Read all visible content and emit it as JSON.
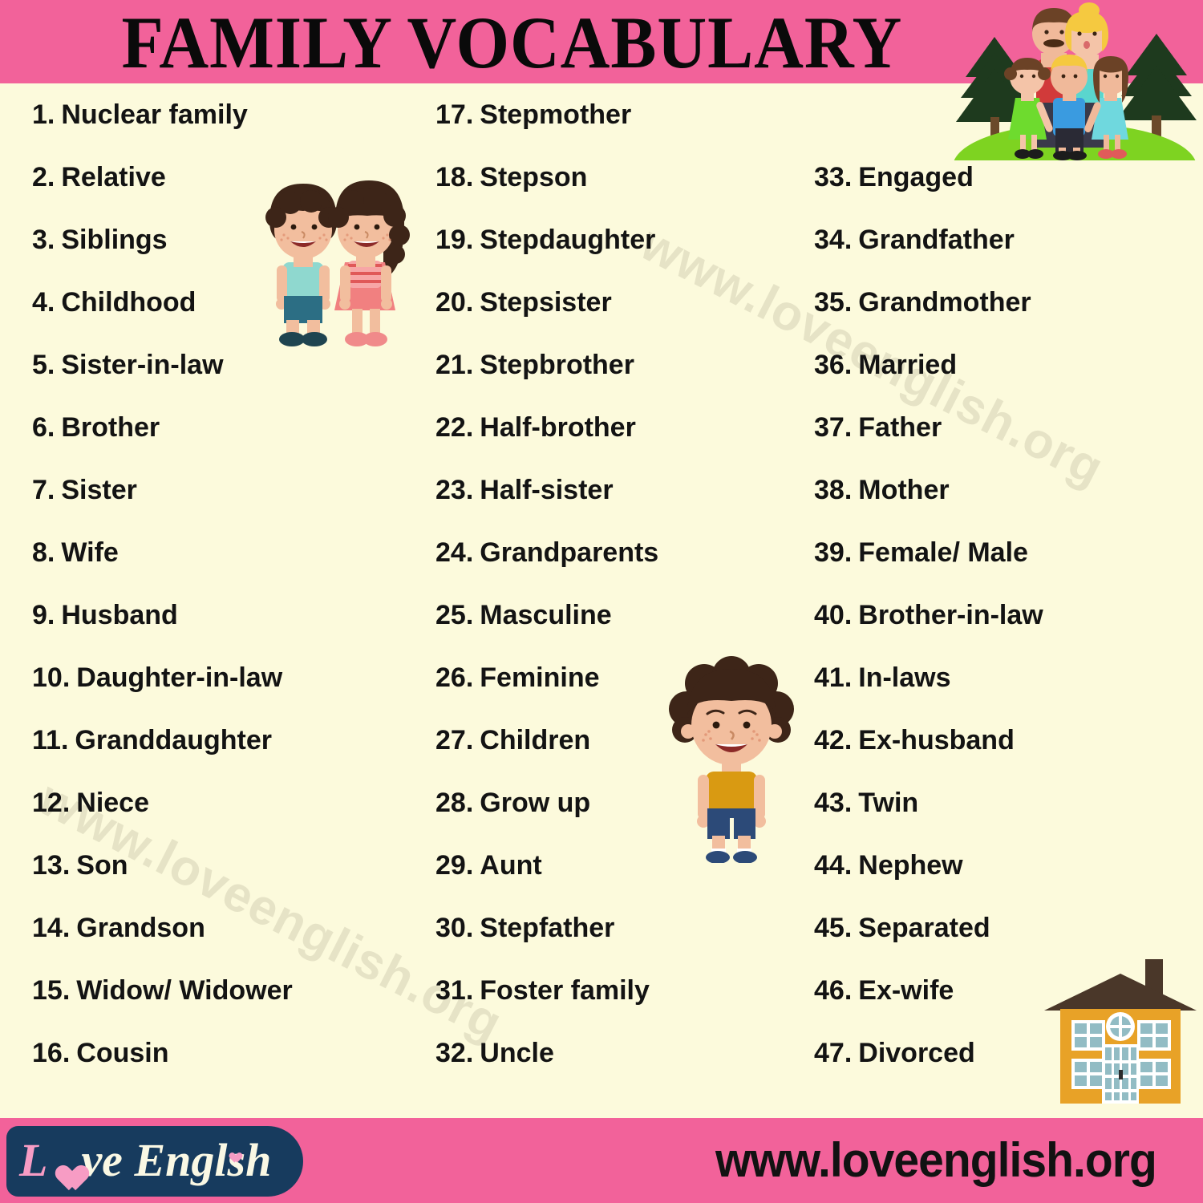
{
  "header": {
    "title": "FAMILY VOCABULARY",
    "band_color": "#F2629A",
    "illustration": "family-in-park-illustration"
  },
  "page": {
    "background_color": "#FCFADC",
    "text_color": "#131313"
  },
  "watermarks": [
    {
      "text": "www.loveenglish.org",
      "color": "#E6E3C6"
    },
    {
      "text": "www.loveenglish.org",
      "color": "#E6E3C6"
    }
  ],
  "illustrations": [
    {
      "name": "boy-and-girl-holding-hands-illustration"
    },
    {
      "name": "smiling-boy-illustration"
    },
    {
      "name": "house-illustration"
    }
  ],
  "columns": [
    {
      "name": "column-one",
      "items": [
        {
          "num": "1.",
          "label": "Nuclear family"
        },
        {
          "num": "2.",
          "label": "Relative"
        },
        {
          "num": "3.",
          "label": "Siblings"
        },
        {
          "num": "4.",
          "label": "Childhood"
        },
        {
          "num": "5.",
          "label": "Sister-in-law"
        },
        {
          "num": "6.",
          "label": "Brother"
        },
        {
          "num": "7.",
          "label": "Sister"
        },
        {
          "num": "8.",
          "label": "Wife"
        },
        {
          "num": "9.",
          "label": "Husband"
        },
        {
          "num": "10.",
          "label": "Daughter-in-law"
        },
        {
          "num": "11.",
          "label": "Granddaughter"
        },
        {
          "num": "12.",
          "label": "Niece"
        },
        {
          "num": "13.",
          "label": "Son"
        },
        {
          "num": "14.",
          "label": "Grandson"
        },
        {
          "num": "15.",
          "label": "Widow/ Widower"
        },
        {
          "num": "16.",
          "label": "Cousin"
        }
      ]
    },
    {
      "name": "column-two",
      "items": [
        {
          "num": "17.",
          "label": "Stepmother"
        },
        {
          "num": "18.",
          "label": "Stepson"
        },
        {
          "num": "19.",
          "label": "Stepdaughter"
        },
        {
          "num": "20.",
          "label": "Stepsister"
        },
        {
          "num": "21.",
          "label": "Stepbrother"
        },
        {
          "num": "22.",
          "label": "Half-brother"
        },
        {
          "num": "23.",
          "label": "Half-sister"
        },
        {
          "num": "24.",
          "label": "Grandparents"
        },
        {
          "num": "25.",
          "label": "Masculine"
        },
        {
          "num": "26.",
          "label": "Feminine"
        },
        {
          "num": "27.",
          "label": "Children"
        },
        {
          "num": "28.",
          "label": "Grow up"
        },
        {
          "num": "29.",
          "label": "Aunt"
        },
        {
          "num": "30.",
          "label": "Stepfather"
        },
        {
          "num": "31.",
          "label": "Foster family"
        },
        {
          "num": "32.",
          "label": "Uncle"
        }
      ]
    },
    {
      "name": "column-three",
      "items": [
        {
          "num": "33.",
          "label": "Engaged"
        },
        {
          "num": "34.",
          "label": "Grandfather"
        },
        {
          "num": "35.",
          "label": "Grandmother"
        },
        {
          "num": "36.",
          "label": "Married"
        },
        {
          "num": "37.",
          "label": "Father"
        },
        {
          "num": "38.",
          "label": "Mother"
        },
        {
          "num": "39.",
          "label": "Female/ Male"
        },
        {
          "num": "40.",
          "label": "Brother-in-law"
        },
        {
          "num": "41.",
          "label": "In-laws"
        },
        {
          "num": "42.",
          "label": "Ex-husband"
        },
        {
          "num": "43.",
          "label": "Twin"
        },
        {
          "num": "44.",
          "label": "Nephew"
        },
        {
          "num": "45.",
          "label": "Separated"
        },
        {
          "num": "46.",
          "label": "Ex-wife"
        },
        {
          "num": "47.",
          "label": "Divorced"
        }
      ]
    }
  ],
  "footer": {
    "band_color": "#F2629A",
    "logo": {
      "badge_color": "#173B5E",
      "word_first": "L",
      "word_rest": "ve",
      "word_second": "Engl",
      "word_tail": "sh",
      "accent_color": "#F79CC4"
    },
    "url": "www.loveenglish.org"
  }
}
